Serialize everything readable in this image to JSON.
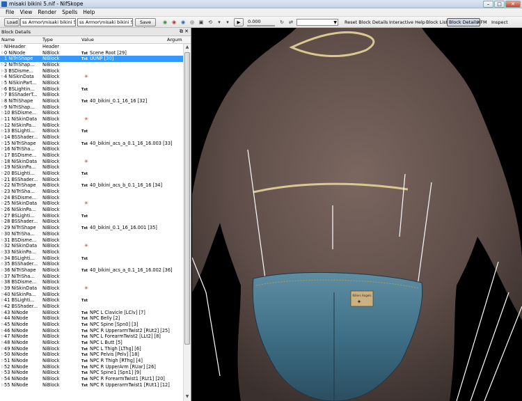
{
  "window": {
    "title": "misaki bikini 5.nif - NifSkope"
  },
  "menu": [
    "File",
    "View",
    "Render",
    "Spells",
    "Help"
  ],
  "toolbar": {
    "load_label": "Load",
    "load_path": "ss Armor\\misaki bikini 5.nif",
    "save_path": "ss Armor\\misaki bikini 5.nif",
    "save_label": "Save As",
    "slider_value": "0.000",
    "reset_label": "Reset Block Details",
    "help_label": "Interactive Help",
    "blocklist_label": "Block List",
    "blockdetails_label": "Block Details",
    "kfm_label": "KFM",
    "inspect_label": "Inspect"
  },
  "panel": {
    "title": "Block Details",
    "columns": [
      "Name",
      "Type",
      "Value",
      "Argum"
    ]
  },
  "rows": [
    {
      "name": "NiHeader",
      "type": "Header",
      "value": ""
    },
    {
      "name": "0 NiNode",
      "type": "NiBlock",
      "value": "Scene Root [29]",
      "txt": true
    },
    {
      "name": "1 NiTriShape",
      "type": "NiBlock",
      "value": "UUNP [30]",
      "txt": true
    },
    {
      "name": "2 NiTriShap...",
      "type": "NiBlock",
      "value": ""
    },
    {
      "name": "3 BSDisme...",
      "type": "NiBlock",
      "value": ""
    },
    {
      "name": "4 NiSkinData",
      "type": "NiBlock",
      "value": "",
      "bone": true
    },
    {
      "name": "5 NiSkinPart...",
      "type": "NiBlock",
      "value": ""
    },
    {
      "name": "6 BSLightin...",
      "type": "NiBlock",
      "value": "",
      "txt": true
    },
    {
      "name": "7 BSShaderT...",
      "type": "NiBlock",
      "value": ""
    },
    {
      "name": "8 NiTriShape",
      "type": "NiBlock",
      "value": "40_bikini_0.1_16_16 [32]",
      "txt": true
    },
    {
      "name": "9 NiTriShap...",
      "type": "NiBlock",
      "value": ""
    },
    {
      "name": "10 BSDisme...",
      "type": "NiBlock",
      "value": ""
    },
    {
      "name": "11 NiSkinData",
      "type": "NiBlock",
      "value": "",
      "bone": true
    },
    {
      "name": "12 NiSkinPa...",
      "type": "NiBlock",
      "value": ""
    },
    {
      "name": "13 BSLighti...",
      "type": "NiBlock",
      "value": "",
      "txt": true
    },
    {
      "name": "14 BSShader...",
      "type": "NiBlock",
      "value": ""
    },
    {
      "name": "15 NiTriShape",
      "type": "NiBlock",
      "value": "40_bikini_acs_a_0.1_16_16.003 [33]",
      "txt": true
    },
    {
      "name": "16 NiTriSha...",
      "type": "NiBlock",
      "value": ""
    },
    {
      "name": "17 BSDisme...",
      "type": "NiBlock",
      "value": ""
    },
    {
      "name": "18 NiSkinData",
      "type": "NiBlock",
      "value": "",
      "bone": true
    },
    {
      "name": "19 NiSkinPa...",
      "type": "NiBlock",
      "value": ""
    },
    {
      "name": "20 BSLighti...",
      "type": "NiBlock",
      "value": "",
      "txt": true
    },
    {
      "name": "21 BSShader...",
      "type": "NiBlock",
      "value": ""
    },
    {
      "name": "22 NiTriShape",
      "type": "NiBlock",
      "value": "40_bikini_acs_b_0.1_16_16 [34]",
      "txt": true
    },
    {
      "name": "23 NiTriSha...",
      "type": "NiBlock",
      "value": ""
    },
    {
      "name": "24 BSDisme...",
      "type": "NiBlock",
      "value": ""
    },
    {
      "name": "25 NiSkinData",
      "type": "NiBlock",
      "value": "",
      "bone": true
    },
    {
      "name": "26 NiSkinPa...",
      "type": "NiBlock",
      "value": ""
    },
    {
      "name": "27 BSLighti...",
      "type": "NiBlock",
      "value": "",
      "txt": true
    },
    {
      "name": "28 BSShader...",
      "type": "NiBlock",
      "value": ""
    },
    {
      "name": "29 NiTriShape",
      "type": "NiBlock",
      "value": "40_bikini_0.1_16_16.001 [35]",
      "txt": true
    },
    {
      "name": "30 NiTriSha...",
      "type": "NiBlock",
      "value": ""
    },
    {
      "name": "31 BSDisme...",
      "type": "NiBlock",
      "value": ""
    },
    {
      "name": "32 NiSkinData",
      "type": "NiBlock",
      "value": "",
      "bone": true
    },
    {
      "name": "33 NiSkinPa...",
      "type": "NiBlock",
      "value": ""
    },
    {
      "name": "34 BSLighti...",
      "type": "NiBlock",
      "value": "",
      "txt": true
    },
    {
      "name": "35 BSShader...",
      "type": "NiBlock",
      "value": ""
    },
    {
      "name": "36 NiTriShape",
      "type": "NiBlock",
      "value": "40_bikini_acs_a_0.1_16_16.002 [36]",
      "txt": true
    },
    {
      "name": "37 NiTriSha...",
      "type": "NiBlock",
      "value": ""
    },
    {
      "name": "38 BSDisme...",
      "type": "NiBlock",
      "value": ""
    },
    {
      "name": "39 NiSkinData",
      "type": "NiBlock",
      "value": "",
      "bone": true
    },
    {
      "name": "40 NiSkinPa...",
      "type": "NiBlock",
      "value": ""
    },
    {
      "name": "41 BSLighti...",
      "type": "NiBlock",
      "value": "",
      "txt": true
    },
    {
      "name": "42 BSShader...",
      "type": "NiBlock",
      "value": ""
    },
    {
      "name": "43 NiNode",
      "type": "NiBlock",
      "value": "NPC L Clavicle [LClv] [7]",
      "txt": true
    },
    {
      "name": "44 NiNode",
      "type": "NiBlock",
      "value": "NPC Belly [2]",
      "txt": true
    },
    {
      "name": "45 NiNode",
      "type": "NiBlock",
      "value": "NPC Spine [Spn0] [3]",
      "txt": true
    },
    {
      "name": "46 NiNode",
      "type": "NiBlock",
      "value": "NPC R UpperarmTwist2 [RUt2] [25]",
      "txt": true
    },
    {
      "name": "47 NiNode",
      "type": "NiBlock",
      "value": "NPC L ForearmTwist2 [LLt2] [8]",
      "txt": true
    },
    {
      "name": "48 NiNode",
      "type": "NiBlock",
      "value": "NPC L Butt [5]",
      "txt": true
    },
    {
      "name": "49 NiNode",
      "type": "NiBlock",
      "value": "NPC L Thigh [LThg] [6]",
      "txt": true
    },
    {
      "name": "50 NiNode",
      "type": "NiBlock",
      "value": "NPC Pelvis [Pelv] [18]",
      "txt": true
    },
    {
      "name": "51 NiNode",
      "type": "NiBlock",
      "value": "NPC R Thigh [RThg] [4]",
      "txt": true
    },
    {
      "name": "52 NiNode",
      "type": "NiBlock",
      "value": "NPC R UpperArm [RUar] [26]",
      "txt": true
    },
    {
      "name": "53 NiNode",
      "type": "NiBlock",
      "value": "NPC Spine1 [Spn1] [9]",
      "txt": true
    },
    {
      "name": "54 NiNode",
      "type": "NiBlock",
      "value": "NPC R ForearmTwist1 [RLt1] [20]",
      "txt": true
    },
    {
      "name": "55 NiNode",
      "type": "NiBlock",
      "value": "NPC R UpperarmTwist1 [RUt1] [12]",
      "txt": true
    }
  ],
  "selected_row": 2,
  "txt_tag": "Txt",
  "viewport": {
    "label_tag": "Killers Angels"
  }
}
